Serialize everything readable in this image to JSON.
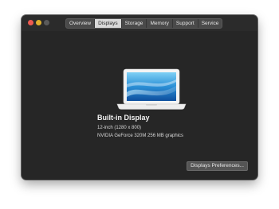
{
  "window": {
    "tabs": [
      {
        "label": "Overview",
        "active": false
      },
      {
        "label": "Displays",
        "active": true
      },
      {
        "label": "Storage",
        "active": false
      },
      {
        "label": "Memory",
        "active": false
      },
      {
        "label": "Support",
        "active": false
      },
      {
        "label": "Service",
        "active": false
      }
    ]
  },
  "display": {
    "title": "Built-in Display",
    "size": "12-inch (1280 x 800)",
    "graphics": "NVIDIA GeForce 320M 256 MB graphics",
    "icon": "laptop-icon"
  },
  "buttons": {
    "preferences_label": "Displays Preferences..."
  },
  "colors": {
    "window_bg": "#262626",
    "close": "#ef5a50",
    "minimize": "#e0b12d",
    "active_tab": "#d9d9d9"
  }
}
